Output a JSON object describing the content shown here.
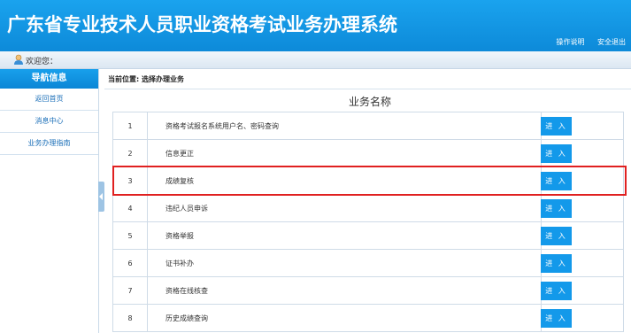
{
  "header": {
    "title": "广东省专业技术人员职业资格考试业务办理系统",
    "links": [
      "操作说明",
      "安全退出"
    ]
  },
  "welcome": {
    "text": "欢迎您："
  },
  "sidebar": {
    "title": "导航信息",
    "items": [
      {
        "label": "返回首页"
      },
      {
        "label": "消息中心"
      },
      {
        "label": "业务办理指南"
      }
    ]
  },
  "main": {
    "breadcrumb": "当前位置: 选择办理业务",
    "table_title": "业务名称",
    "enter_label": "进 入",
    "rows": [
      {
        "num": "1",
        "name": "资格考试报名系统用户名、密码查询"
      },
      {
        "num": "2",
        "name": "信息更正"
      },
      {
        "num": "3",
        "name": "成绩复核"
      },
      {
        "num": "4",
        "name": "违纪人员申诉"
      },
      {
        "num": "5",
        "name": "资格举报"
      },
      {
        "num": "6",
        "name": "证书补办"
      },
      {
        "num": "7",
        "name": "资格在线核查"
      },
      {
        "num": "8",
        "name": "历史成绩查询"
      }
    ]
  },
  "colors": {
    "header_blue": "#1399ea",
    "highlight_red": "#e02020"
  }
}
